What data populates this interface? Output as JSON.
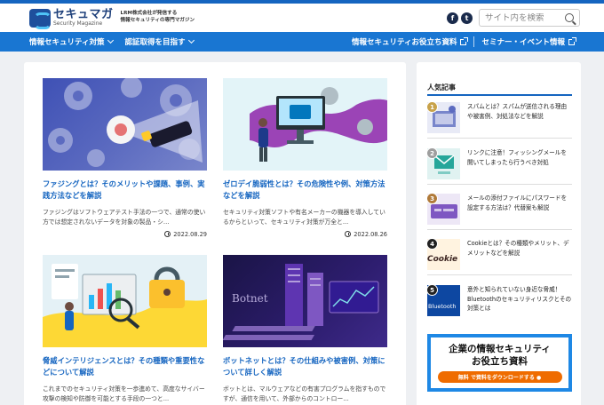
{
  "header": {
    "logo_name": "セキュマガ",
    "logo_sub": "Security Magazine",
    "tagline_1": "LRM株式会社が発信する",
    "tagline_2": "情報セキュリティの専門マガジン",
    "search_placeholder": "サイト内を検索",
    "facebook_glyph": "f",
    "twitter_glyph": "t"
  },
  "nav": {
    "items": [
      {
        "label": "情報セキュリティ対策"
      },
      {
        "label": "認証取得を目指す"
      }
    ],
    "right_items": [
      {
        "label": "情報セキュリティお役立ち資料"
      },
      {
        "label": "セミナー・イベント情報"
      }
    ]
  },
  "articles": [
    {
      "title": "ファジングとは？そのメリットや課題、事例、実践方法などを解説",
      "excerpt": "ファジングはソフトウェアテスト手法の一つで、通常の使い方では想定されないデータを対象の製品・シ...",
      "date": "2022.08.29"
    },
    {
      "title": "ゼロデイ脆弱性とは？その危険性や例、対策方法などを解説",
      "excerpt": "セキュリティ対策ソフトや有名メーカーの機器を導入しているからといって、セキュリティ対策が万全と...",
      "date": "2022.08.26"
    },
    {
      "title": "脅威インテリジェンスとは？その種類や重要性などについて解説",
      "excerpt": "これまでのセキュリティ対策を一歩進めて、高度なサイバー攻撃の検知や防御を可能とする手段の一つと...",
      "date": ""
    },
    {
      "title": "ボットネットとは？その仕組みや被害例、対策について詳しく解説",
      "excerpt": "ボットとは、マルウェアなどの有害プログラムを指すものですが、通信を用いて、外部からのコントロー...",
      "date": "",
      "thumb_text": "Botnet"
    }
  ],
  "sidebar": {
    "title": "人気記事",
    "ranking": [
      {
        "rank": "1",
        "text": "スパムとは？スパムが送信される理由や被害例、対処法などを解説",
        "badge_color": "#c8a24a"
      },
      {
        "rank": "2",
        "text": "リンクに注意！フィッシングメールを開いてしまったら行うべき対処",
        "badge_color": "#9e9e9e"
      },
      {
        "rank": "3",
        "text": "メールの添付ファイルにパスワードを設定する方法は？代替案も解説",
        "badge_color": "#b07a3a"
      },
      {
        "rank": "4",
        "text": "Cookieとは？その種類やメリット、デメリットなどを解説",
        "badge_color": "#222222",
        "thumb_text": "Cookie"
      },
      {
        "rank": "5",
        "text": "意外と知られていない身近な脅威！Bluetoothのセキュリティリスクとその対策とは",
        "badge_color": "#222222",
        "thumb_text": "Bluetooth"
      }
    ],
    "banner": {
      "line1": "企業の情報セキュリティ",
      "line2": "お役立ち資料",
      "button": "無料 で資料をダウンロードする ●"
    }
  },
  "colors": {
    "brand_blue": "#1976d2",
    "link_blue": "#1565c0",
    "cta_orange": "#ef6c00"
  }
}
